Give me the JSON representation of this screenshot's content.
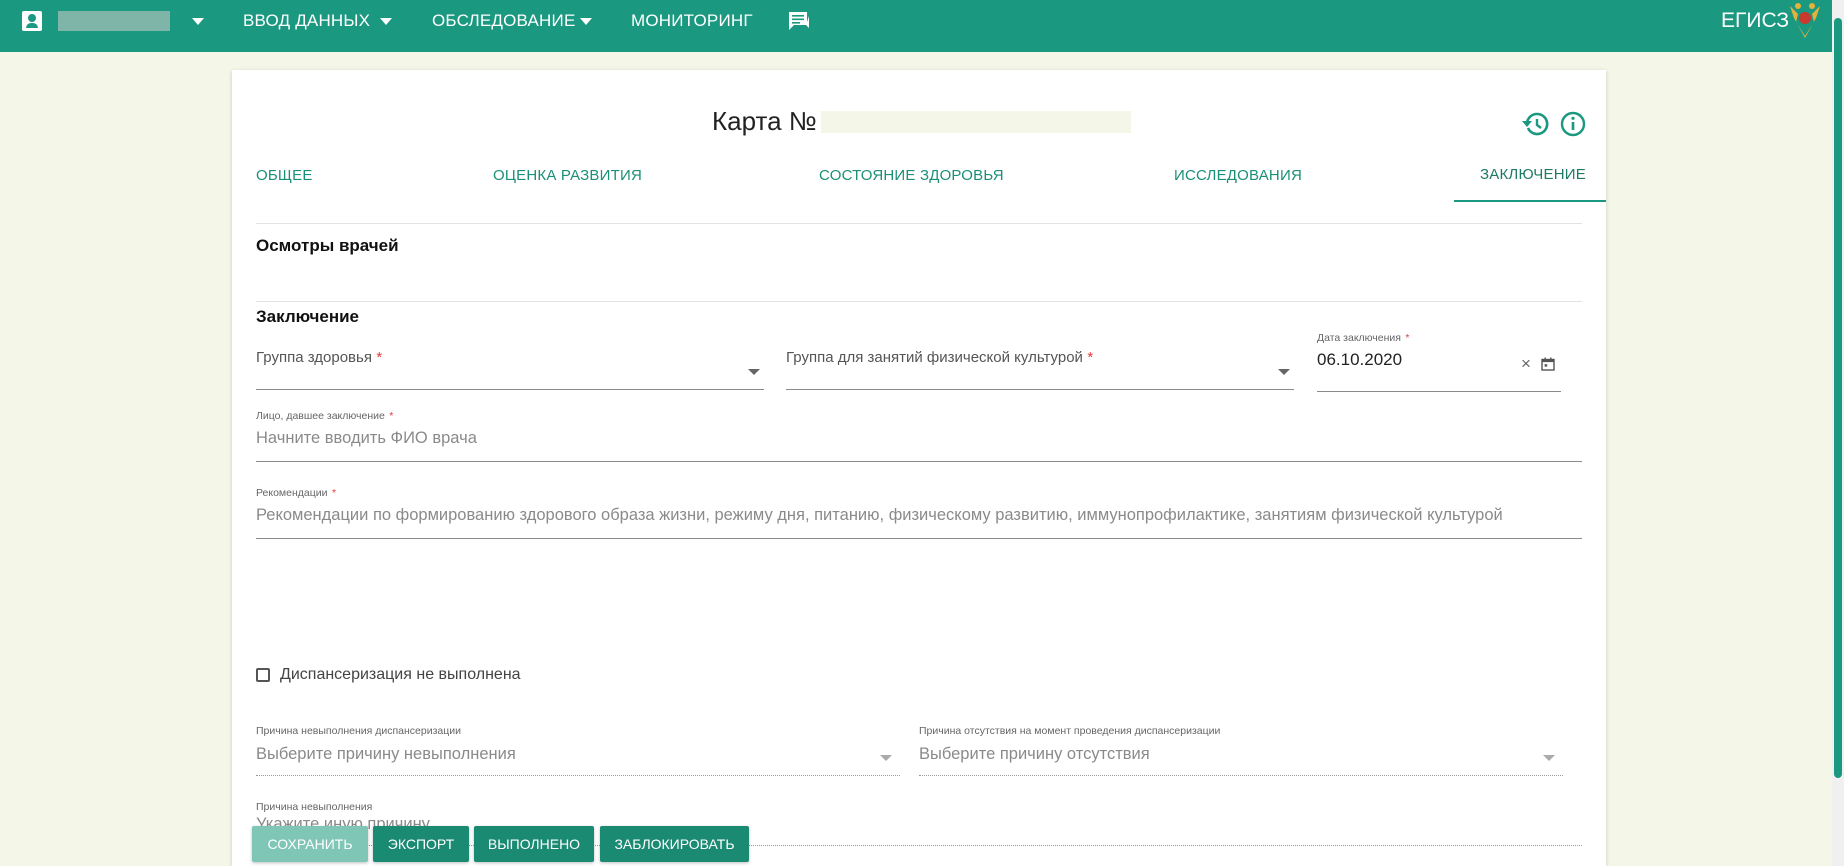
{
  "topbar": {
    "nav": [
      {
        "label": "ВВОД ДАННЫХ"
      },
      {
        "label": "ОБСЛЕДОВАНИЕ"
      },
      {
        "label": "МОНИТОРИНГ"
      }
    ],
    "brand": "ЕГИСЗ",
    "icons": [
      "user-icon",
      "chevron-down-icon",
      "chat-icon",
      "emblem-icon"
    ]
  },
  "card": {
    "title": "Карта №",
    "tabs": [
      {
        "label": "ОБЩЕЕ"
      },
      {
        "label": "ОЦЕНКА РАЗВИТИЯ"
      },
      {
        "label": "СОСТОЯНИЕ ЗДОРОВЬЯ"
      },
      {
        "label": "ИССЛЕДОВАНИЯ"
      },
      {
        "label": "ЗАКЛЮЧЕНИЕ"
      }
    ],
    "active_tab": "ЗАКЛЮЧЕНИЕ"
  },
  "doctors_section": {
    "title": "Осмотры врачей"
  },
  "conclusion": {
    "title": "Заключение",
    "health_group": {
      "label": "Группа здоровья",
      "required": "*"
    },
    "pe_group": {
      "label": "Группа для занятий физической культурой",
      "required": "*"
    },
    "date": {
      "label": "Дата заключения",
      "required": "*",
      "value": "06.10.2020"
    },
    "person": {
      "label": "Лицо, давшее заключение",
      "required": "*",
      "placeholder": "Начните вводить ФИО врача"
    },
    "recommendations": {
      "label": "Рекомендации",
      "required": "*",
      "placeholder": "Рекомендации по формированию здорового образа жизни, режиму дня, питанию, физическому развитию, иммунопрофилактике, занятиям физической культурой"
    },
    "not_done_checkbox": {
      "label": "Диспансеризация не выполнена",
      "checked": false
    },
    "reason_not_done": {
      "label": "Причина невыполнения диспансеризации",
      "placeholder": "Выберите причину невыполнения"
    },
    "reason_absence": {
      "label": "Причина отсутствия на момент проведения диспансеризации",
      "placeholder": "Выберите причину отсутствия"
    },
    "other_reason": {
      "label": "Причина невыполнения",
      "placeholder": "Укажите иную причину"
    }
  },
  "buttons": {
    "save": "СОХРАНИТЬ",
    "export": "ЭКСПОРТ",
    "done": "ВЫПОЛНЕНО",
    "block": "ЗАБЛОКИРОВАТЬ"
  },
  "colors": {
    "primary": "#1b9880",
    "background": "#f4f7e8",
    "required": "#e53935"
  }
}
